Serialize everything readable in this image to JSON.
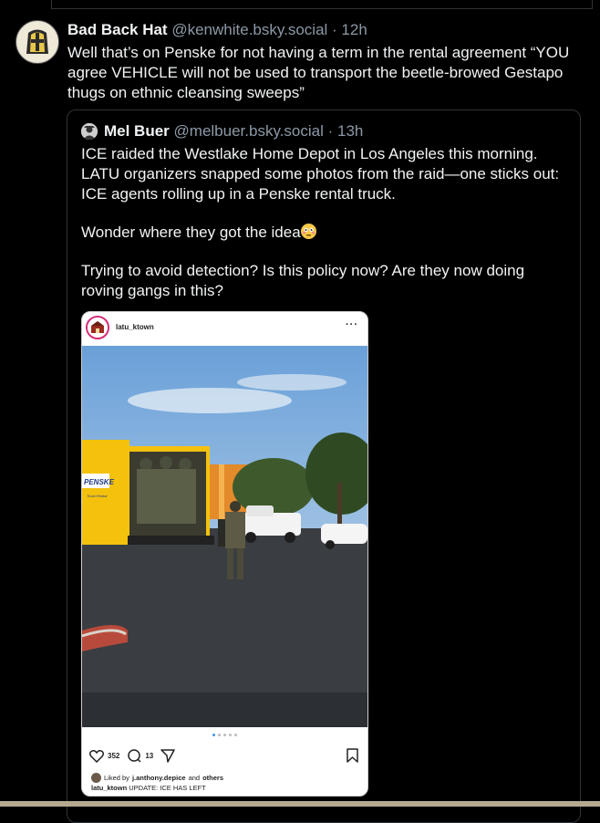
{
  "post": {
    "author_name": "Bad Back Hat",
    "author_handle": "@kenwhite.bsky.social",
    "separator": " · ",
    "time": "12h",
    "text": "Well that’s on Penske for not having a term in the rental agreement “YOU agree VEHICLE will not be used to transport the beetle-browed Gestapo thugs on ethnic cleansing sweeps”"
  },
  "quote": {
    "author_name": "Mel Buer",
    "author_handle": "@melbuer.bsky.social",
    "separator": " · ",
    "time": "13h",
    "paragraphs": [
      "ICE raided the Westlake Home Depot in Los Angeles this morning. LATU organizers snapped some photos from the raid—one sticks out: ICE agents rolling up in a Penske rental truck.",
      "Wonder where they got the idea",
      "Trying to avoid detection? Is this policy now? Are they now doing roving gangs in this?"
    ],
    "emoji_icon": "flushed-face-emoji"
  },
  "instagram": {
    "username": "latu_ktown",
    "more": "···",
    "truck_brand": "PENSKE",
    "truck_sub": "Truck Rental",
    "likes": "352",
    "comments": "13",
    "liked_by_prefix": "Liked by ",
    "liked_by_user": "j.anthony.depice",
    "liked_by_suffix": " and ",
    "liked_by_others": "others",
    "caption_user": "latu_ktown",
    "caption_text": " UPDATE: ICE HAS LEFT",
    "carousel_count": 5,
    "carousel_active": 1
  },
  "colors": {
    "background": "#000000",
    "text": "#f1f3f5",
    "muted": "#8c99a6",
    "border": "#2e3439",
    "penske_yellow": "#f4c20d"
  }
}
